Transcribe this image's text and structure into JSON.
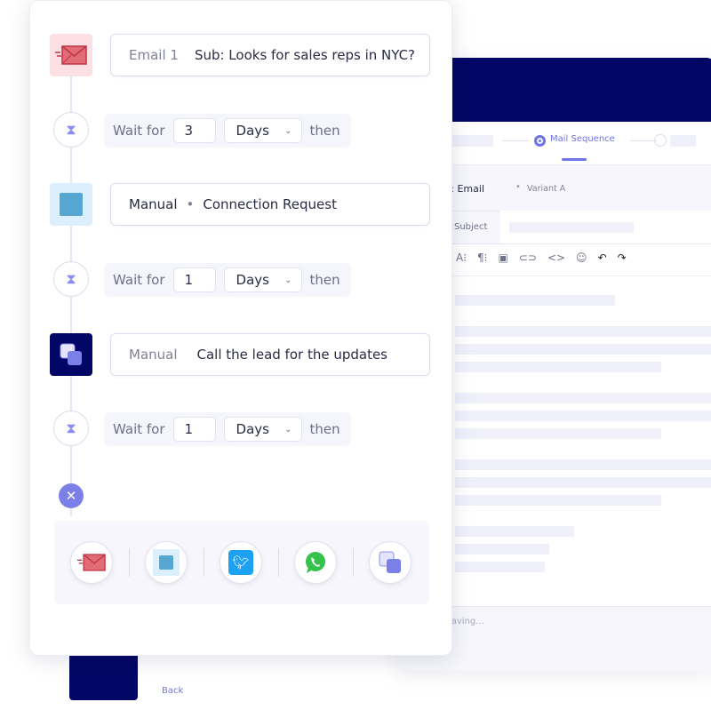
{
  "editor": {
    "stepper": {
      "active_label": "Mail Sequence"
    },
    "stage_title": "Stage 1: Email",
    "variant": "Variant A",
    "subject_label": "Subject",
    "toolbar": [
      "font-size-icon",
      "paragraph-icon",
      "image-icon",
      "link-icon",
      "code-icon",
      "emoji-icon",
      "undo-icon",
      "redo-icon"
    ],
    "footer_status": "Auto Saving...",
    "back_label": "Back"
  },
  "sequence": {
    "steps": [
      {
        "type": "email",
        "tag": "Email 1",
        "text": "Sub: Looks for sales reps in NYC?"
      },
      {
        "wait_label": "Wait for",
        "value": "3",
        "unit": "Days",
        "then": "then"
      },
      {
        "type": "manual",
        "tag": "Manual",
        "text": "Connection Request"
      },
      {
        "wait_label": "Wait for",
        "value": "1",
        "unit": "Days",
        "then": "then"
      },
      {
        "type": "manual-task",
        "tag": "Manual",
        "text": "Call the lead for the updates"
      },
      {
        "wait_label": "Wait for",
        "value": "1",
        "unit": "Days",
        "then": "then"
      }
    ],
    "palette": [
      "email-icon",
      "linkedin-icon",
      "twitter-icon",
      "whatsapp-icon",
      "manual-task-icon"
    ]
  },
  "colors": {
    "accent": "#6f73e6",
    "navy": "#020664",
    "email": "#e26b78",
    "linkedin": "#55a7d1",
    "twitter": "#1da1f2",
    "whatsapp": "#36c24c"
  }
}
